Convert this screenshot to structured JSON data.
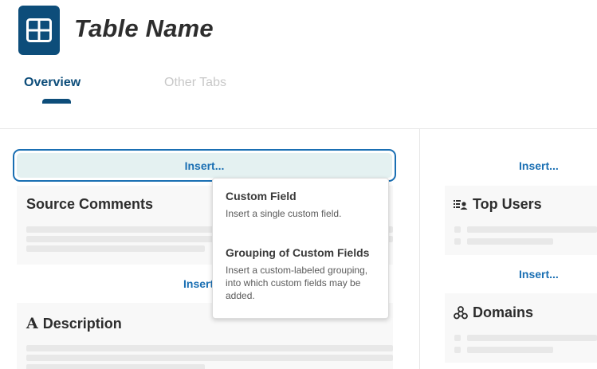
{
  "header": {
    "title": "Table Name",
    "icon": "table-grid-icon",
    "accent_color": "#0d4d7a"
  },
  "tabs": [
    {
      "label": "Overview",
      "active": true
    },
    {
      "label": "Other Tabs",
      "active": false
    }
  ],
  "insert_label": "Insert...",
  "left_column": {
    "source_comments": {
      "title": "Source Comments"
    },
    "description": {
      "title": "Description",
      "icon": "text-a-icon"
    }
  },
  "right_column": {
    "top_users": {
      "title": "Top Users",
      "icon": "users-list-icon"
    },
    "domains": {
      "title": "Domains",
      "icon": "domains-triangle-icon"
    }
  },
  "insert_menu": {
    "items": [
      {
        "title": "Custom Field",
        "description": "Insert a single custom field."
      },
      {
        "title": "Grouping of Custom Fields",
        "description_lines": [
          "Insert a custom-labeled grouping,",
          "into which custom fields may be",
          "added."
        ]
      }
    ]
  },
  "colors": {
    "link": "#1a6fb3",
    "insert_highlight": "#e4f1f1",
    "card_bg": "#f8f8f8"
  }
}
